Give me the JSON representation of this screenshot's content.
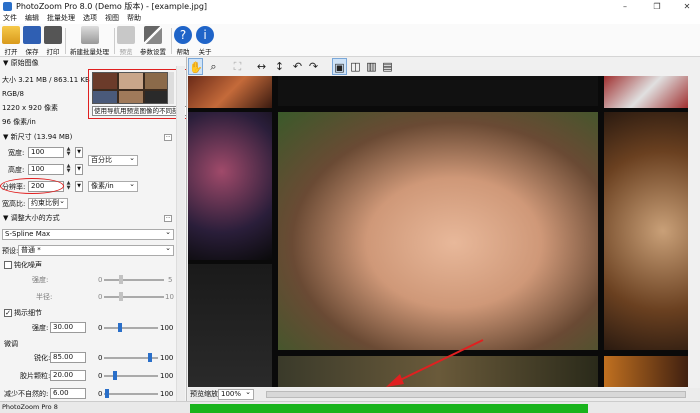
{
  "window": {
    "title": "PhotoZoom Pro 8.0 (Demo 版本) - [example.jpg]",
    "minimize": "–",
    "restore": "❐",
    "close": "✕"
  },
  "menu": [
    "文件",
    "编辑",
    "批量处理",
    "选项",
    "视图",
    "帮助"
  ],
  "toolbar": {
    "open": "打开",
    "save": "保存",
    "print": "打印",
    "batch": "新建批量处理",
    "preview": "预览",
    "settings": "参数设置",
    "help": "帮助",
    "about": "关于"
  },
  "original": {
    "section_title": "原始图像",
    "size": "大小 3.21 MB / 863.11 KB",
    "color_mode": "RGB/8",
    "dimensions": "1220 x 920 像素",
    "resolution": "96 像素/in",
    "tooltip": "使用导航用预览图像的不同部分"
  },
  "newsize": {
    "section_title": "新尺寸 (13.94 MB)",
    "width_label": "宽度:",
    "width_value": "100",
    "height_label": "高度:",
    "height_value": "100",
    "unit_percent": "百分比",
    "resolution_label": "分辨率:",
    "resolution_value": "200",
    "unit_resolution": "像素/in",
    "aspect_label": "宽高比:",
    "aspect_value": "约束比例"
  },
  "resize_method": {
    "section_title": "调整大小的方式",
    "method": "S-Spline Max",
    "preset_label": "预设:",
    "preset_value": "普通 *",
    "soften_label": "钝化噪声",
    "soften_checked": false,
    "strength_label": "强度:",
    "strength_min": "0",
    "strength_max": "5",
    "radius_label": "半径:",
    "radius_min": "0",
    "radius_max": "10",
    "reveal_label": "揭示细节",
    "reveal_checked": true,
    "reveal_strength_label": "强度:",
    "reveal_strength_value": "30.00",
    "reveal_strength_min": "0",
    "reveal_strength_max": "100",
    "reveal_strength_level": 0.3,
    "fine_tune_label": "微调",
    "sharpen_label": "锐化:",
    "sharpen_value": "85.00",
    "sharpen_min": "0",
    "sharpen_max": "100",
    "sharpen_level": 0.85,
    "film_grain_label": "胶片颗粒:",
    "film_grain_value": "20.00",
    "film_grain_min": "0",
    "film_grain_max": "100",
    "film_grain_level": 0.2,
    "reduce_artifacts_label": "减少不自然的:",
    "reduce_artifacts_value": "6.00",
    "reduce_artifacts_min": "0",
    "reduce_artifacts_max": "100",
    "reduce_artifacts_level": 0.06
  },
  "view": {
    "zoom_label": "预览缩放:",
    "zoom_value": "100%"
  },
  "status": {
    "text": "PhotoZoom Pro 8"
  },
  "colors": {
    "accent": "#2a6fc9",
    "progress": "#19b31c",
    "highlight": "#e02020"
  }
}
